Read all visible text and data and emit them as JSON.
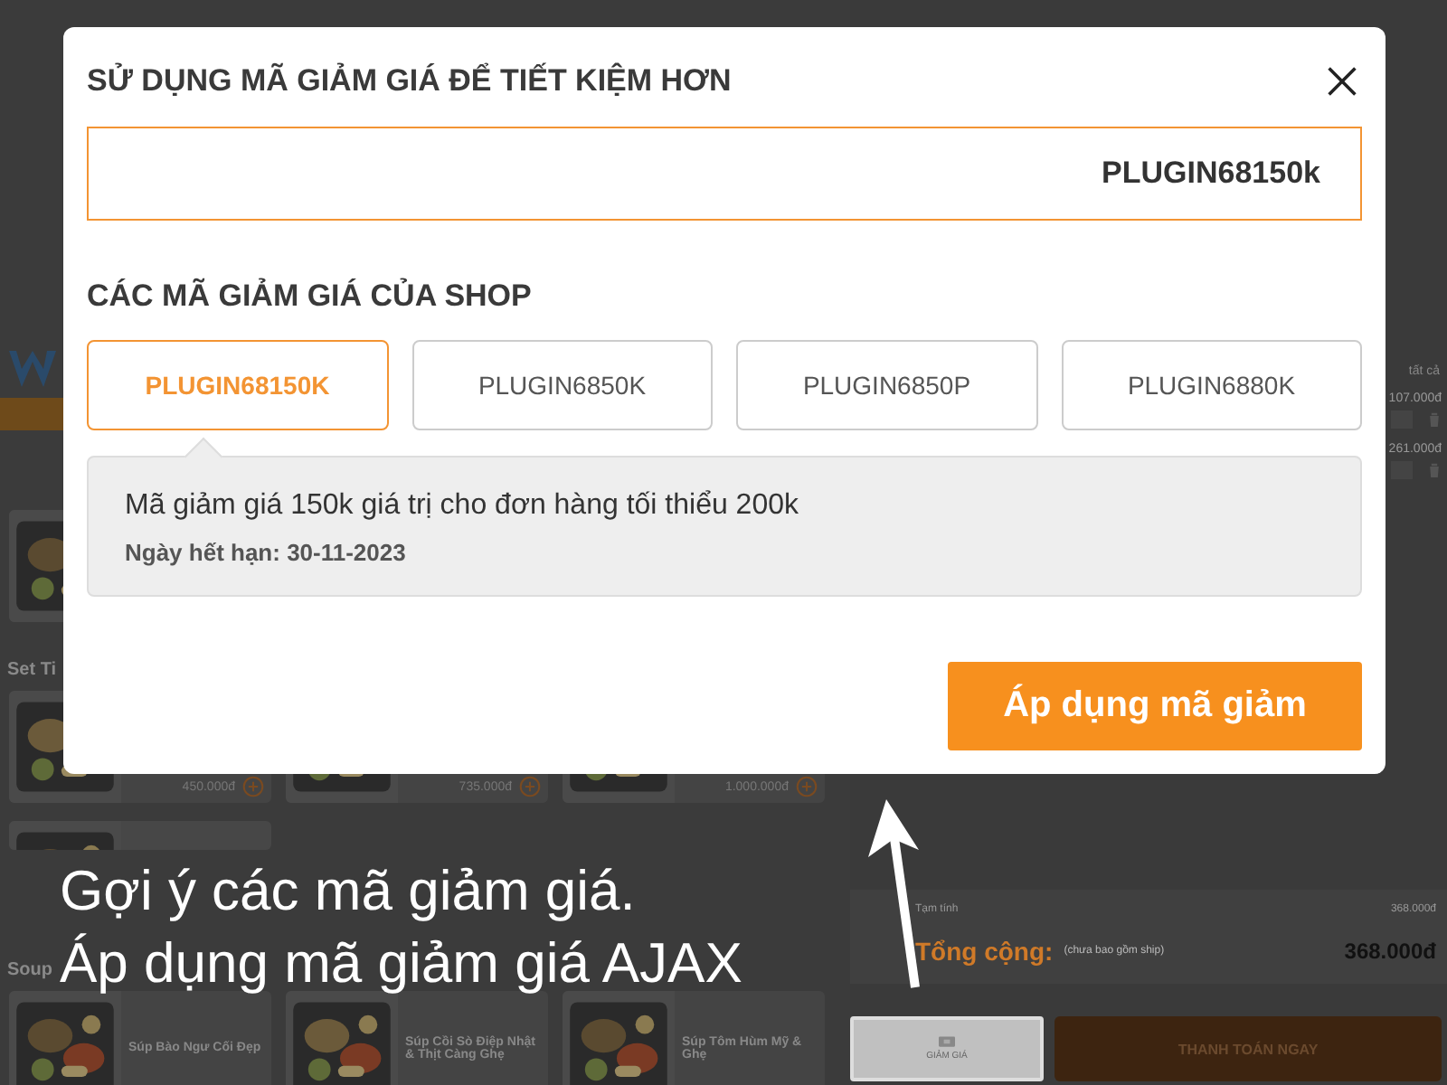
{
  "page": {
    "sections": [
      {
        "cards": [
          {
            "kind": "picture"
          }
        ]
      },
      {
        "title": "Set Ti",
        "cards": [
          {
            "kind": "priced",
            "price": "450.000đ"
          },
          {
            "kind": "priced",
            "price": "735.000đ"
          },
          {
            "kind": "priced",
            "price": "1.000.000đ"
          },
          {
            "kind": "picture"
          }
        ]
      },
      {
        "title": "Soup",
        "cards": [
          {
            "kind": "named",
            "name": "Súp Bào Ngư Cối Đẹp"
          },
          {
            "kind": "named",
            "name": "Súp Cồi Sò Điệp Nhật & Thịt Càng Ghẹ"
          },
          {
            "kind": "named",
            "name": "Súp Tôm Hùm Mỹ & Ghẹ"
          }
        ]
      }
    ],
    "cart": {
      "header": "tất cả",
      "items": [
        {
          "price": "107.000đ"
        },
        {
          "price": "261.000đ"
        }
      ],
      "subtotal_label": "Tạm tính",
      "subtotal": "368.000đ",
      "total_label": "Tổng cộng:",
      "total_note": "(chưa bao gồm ship)",
      "total": "368.000đ",
      "discount_button": "GIẢM GIÁ",
      "checkout_button": "THANH TOÁN NGAY"
    }
  },
  "modal": {
    "title": "SỬ DỤNG MÃ GIẢM GIÁ ĐỂ TIẾT KIỆM HƠN",
    "code_field": {
      "value": "PLUGIN68150k"
    },
    "section_title": "CÁC MÃ GIẢM GIÁ CỦA SHOP",
    "coupons": [
      {
        "code": "PLUGIN68150K",
        "selected": true
      },
      {
        "code": "PLUGIN6850K",
        "selected": false
      },
      {
        "code": "PLUGIN6850P",
        "selected": false
      },
      {
        "code": "PLUGIN6880K",
        "selected": false
      }
    ],
    "details": {
      "description": "Mã giảm giá 150k giá trị cho đơn hàng tối thiểu 200k",
      "expiry": "Ngày hết hạn: 30-11-2023"
    },
    "apply_button": "Áp dụng mã giảm"
  },
  "caption": [
    "Gợi ý các mã giảm giá.",
    "Áp dụng mã giảm giá AJAX"
  ]
}
